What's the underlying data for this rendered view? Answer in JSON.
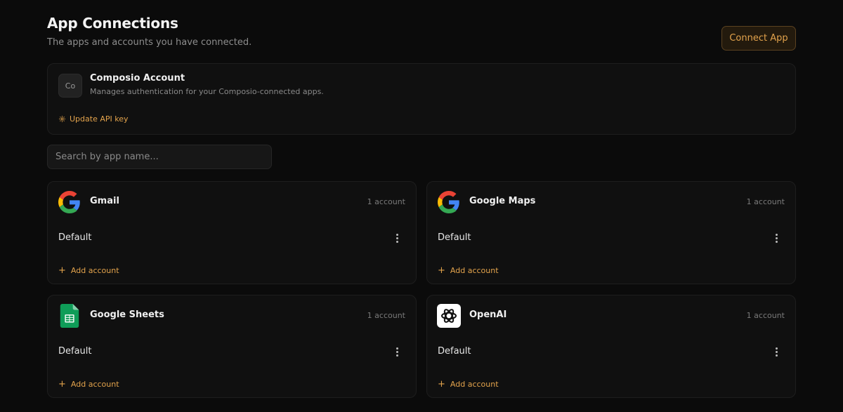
{
  "header": {
    "title": "App Connections",
    "subtitle": "The apps and accounts you have connected.",
    "connect_button": "Connect App"
  },
  "composio": {
    "badge": "Co",
    "name": "Composio Account",
    "description": "Manages authentication for your Composio-connected apps.",
    "update_api_key": "Update API key"
  },
  "search": {
    "placeholder": "Search by app name..."
  },
  "apps": [
    {
      "name": "Gmail",
      "icon": "google-g-icon",
      "count": "1 account",
      "account": "Default",
      "add": "Add account"
    },
    {
      "name": "Google Maps",
      "icon": "google-g-icon",
      "count": "1 account",
      "account": "Default",
      "add": "Add account"
    },
    {
      "name": "Google Sheets",
      "icon": "google-sheets-icon",
      "count": "1 account",
      "account": "Default",
      "add": "Add account"
    },
    {
      "name": "OpenAI",
      "icon": "openai-icon",
      "count": "1 account",
      "account": "Default",
      "add": "Add account"
    }
  ],
  "colors": {
    "accent": "#e3a34c",
    "background": "#0b0b0b",
    "card": "#101010"
  }
}
